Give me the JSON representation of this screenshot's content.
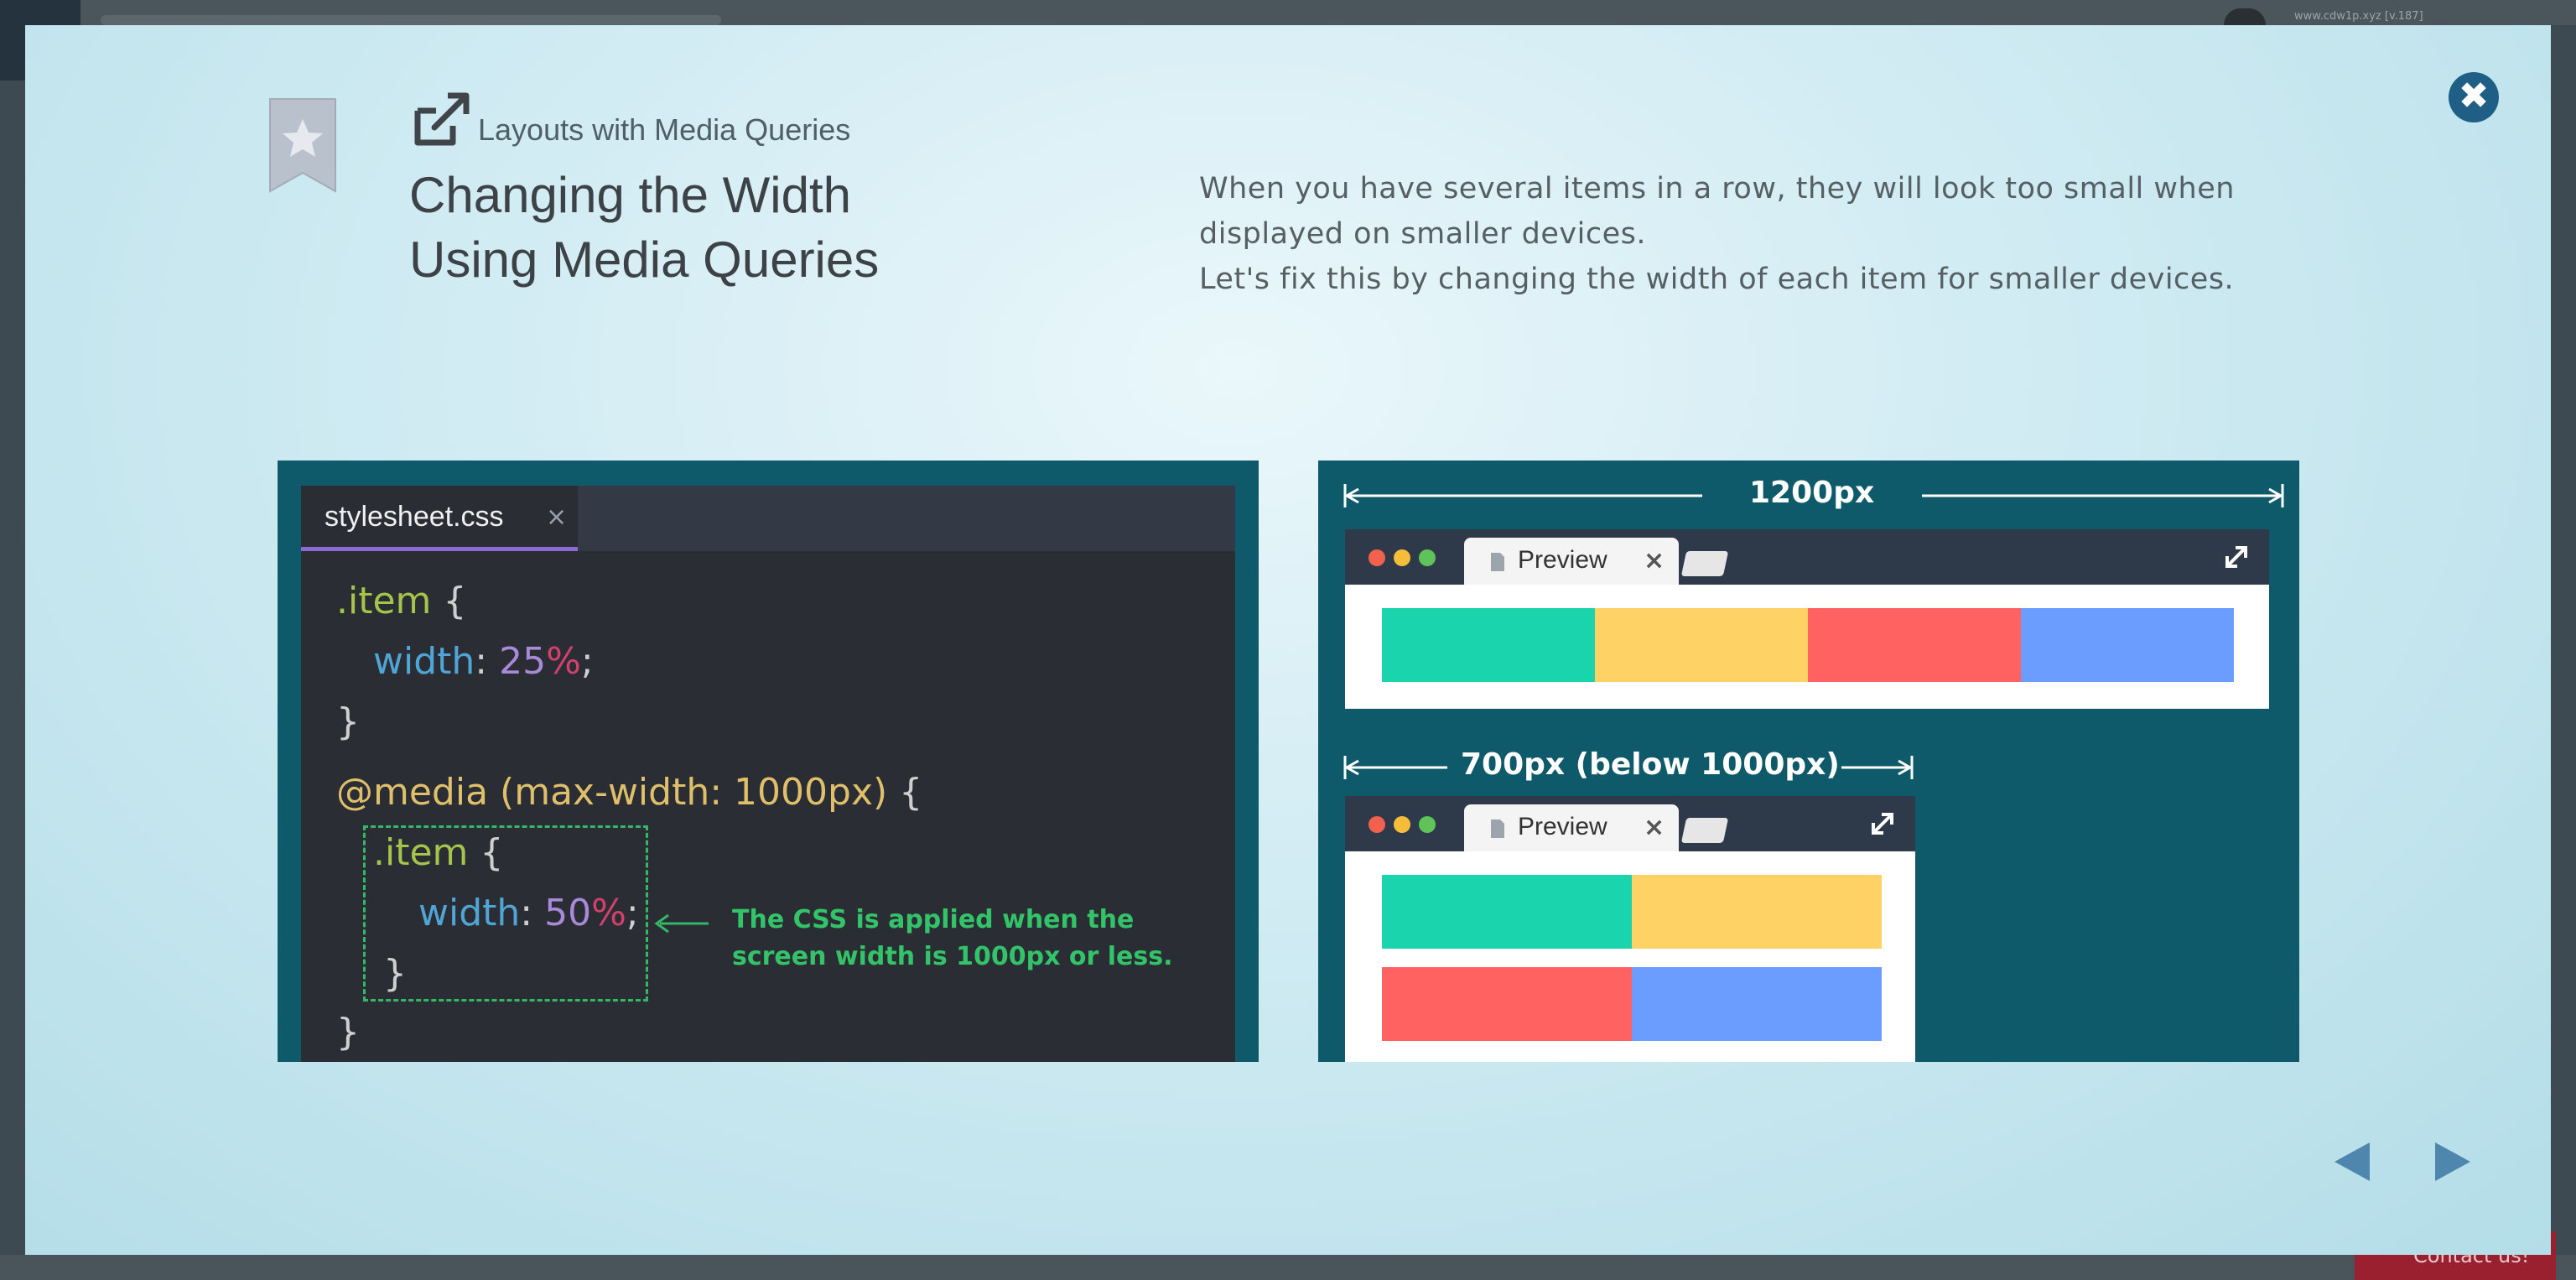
{
  "modal": {
    "section_label": "Layouts with Media Queries",
    "title_line1": "Changing the Width",
    "title_line2": "Using Media Queries",
    "description_line1": "When you have several items in a row, they will look too small when displayed on smaller devices.",
    "description_line2": "Let's fix this by changing the width of each item for smaller devices.",
    "close_label": "✖"
  },
  "code": {
    "filename": "stylesheet.css",
    "tab_close": "×",
    "line1_selector": ".item",
    "line1_brace": " {",
    "line2_prop": "width",
    "line2_colon": ": ",
    "line2_num": "25",
    "line2_pct": "%",
    "line2_semi": ";",
    "line3": "}",
    "line4_media": "@media (max-width: 1000px)",
    "line4_brace": " {",
    "line5_selector": ".item",
    "line5_brace": " {",
    "line6_prop": "width",
    "line6_colon": ": ",
    "line6_num": "50",
    "line6_pct": "%",
    "line6_semi": ";",
    "line7": "}",
    "line8": "}",
    "annotation_line1": "The CSS is applied when the",
    "annotation_line2": "screen width is 1000px or less."
  },
  "preview": {
    "wide_label": "1200px",
    "narrow_label": "700px (below 1000px)",
    "tab_label": "Preview",
    "tab_close": "×",
    "block_colors": [
      "#1ad4ad",
      "#ffd266",
      "#ff6260",
      "#6b9cff"
    ],
    "dot_colors": [
      "#f2604e",
      "#f5bd3a",
      "#5fc35a"
    ]
  },
  "nav": {
    "prev_icon": "triangle-left",
    "next_icon": "triangle-right"
  },
  "bg": {
    "url_hint": "www.cdw1p.xyz [v.187]",
    "contact": "Contact us!"
  }
}
